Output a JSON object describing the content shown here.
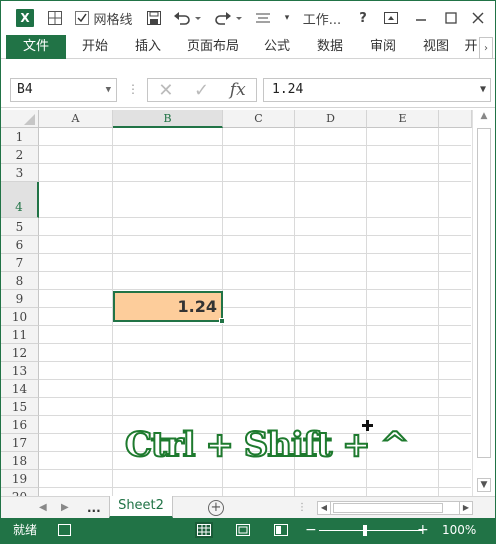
{
  "titlebar": {
    "gridlines_label": "网格线",
    "title": "工作...",
    "help": "?"
  },
  "ribbon": {
    "tabs": [
      {
        "label": "文件",
        "active": true
      },
      {
        "label": "开始"
      },
      {
        "label": "插入"
      },
      {
        "label": "页面布局"
      },
      {
        "label": "公式"
      },
      {
        "label": "数据"
      },
      {
        "label": "审阅"
      },
      {
        "label": "视图"
      },
      {
        "label": "开"
      }
    ]
  },
  "formula_bar": {
    "name_box": "B4",
    "fx": "fx",
    "value": "1.24"
  },
  "grid": {
    "columns": [
      "A",
      "B",
      "C",
      "D",
      "E"
    ],
    "rows": [
      "1",
      "2",
      "3",
      "4",
      "5",
      "6",
      "7",
      "8",
      "9",
      "10",
      "11",
      "12",
      "13",
      "14",
      "15",
      "16",
      "17",
      "18",
      "19",
      "20"
    ],
    "active_cell": {
      "ref": "B4",
      "value": "1.24",
      "fill": "#FDCD9B"
    }
  },
  "overlay": {
    "shortcut": "Ctrl + Shift + ^"
  },
  "sheets": {
    "ellipsis": "...",
    "active": "Sheet2",
    "add": "+"
  },
  "status": {
    "ready": "就绪",
    "minus": "−",
    "plus": "+",
    "zoom": "100%"
  },
  "colors": {
    "accent": "#217346",
    "cell_fill": "#FDCD9B"
  }
}
